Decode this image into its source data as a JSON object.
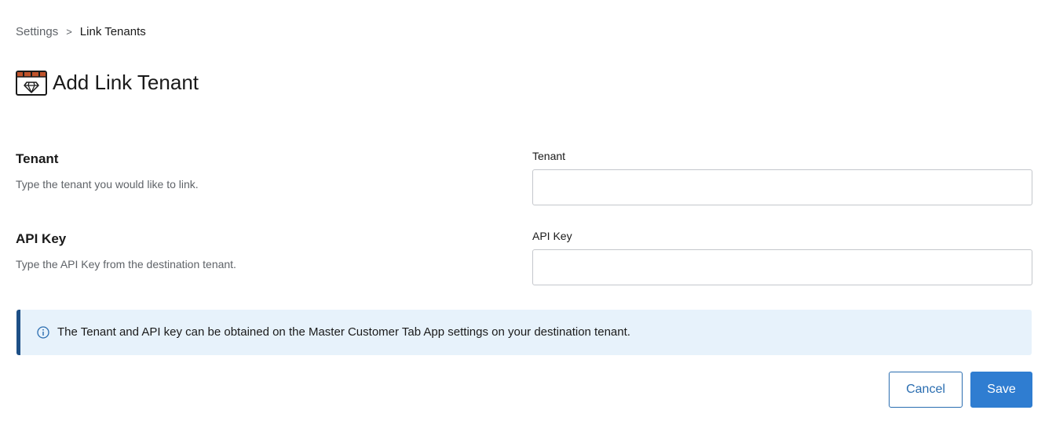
{
  "breadcrumb": {
    "parent": "Settings",
    "separator": ">",
    "current": "Link Tenants"
  },
  "header": {
    "title": "Add Link Tenant",
    "icon": "tenant-diamond-icon"
  },
  "form": {
    "tenant": {
      "section_label": "Tenant",
      "section_desc": "Type the tenant you would like to link.",
      "field_label": "Tenant",
      "value": "",
      "placeholder": ""
    },
    "api_key": {
      "section_label": "API Key",
      "section_desc": "Type the API Key from the destination tenant.",
      "field_label": "API Key",
      "value": "",
      "placeholder": ""
    }
  },
  "info": {
    "icon": "info-icon",
    "text": "The Tenant and API key can be obtained on the Master Customer Tab App settings on your destination tenant."
  },
  "actions": {
    "cancel_label": "Cancel",
    "save_label": "Save"
  },
  "colors": {
    "primary": "#2f7dd1",
    "banner_bg": "#e7f2fb",
    "banner_accent": "#1d4f86",
    "icon_accent": "#c0532b"
  }
}
